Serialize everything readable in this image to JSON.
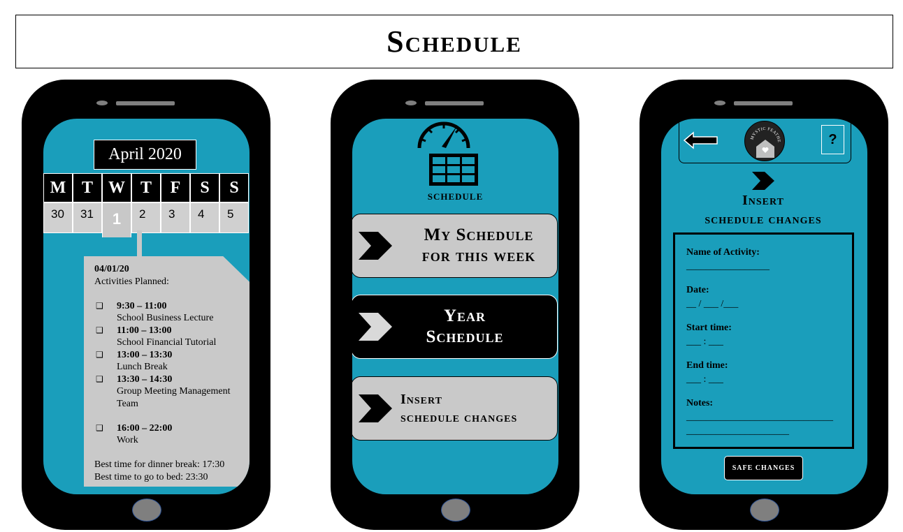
{
  "page": {
    "title": "Schedule"
  },
  "phone1": {
    "month": "April 2020",
    "weekdays": [
      "M",
      "T",
      "W",
      "T",
      "F",
      "S",
      "S"
    ],
    "days": [
      "30",
      "31",
      "1",
      "2",
      "3",
      "4",
      "5"
    ],
    "selected_day_index": 2,
    "date": "04/01/20",
    "activities_header": "Activities Planned:",
    "checkbox_glyph": "❑",
    "activities": [
      {
        "time": "9:30 – 11:00",
        "desc": "School Business   Lecture"
      },
      {
        "time": "11:00 – 13:00",
        "desc": "School Financial Tutorial"
      },
      {
        "time": "13:00 – 13:30",
        "desc": "Lunch Break"
      },
      {
        "time": "13:30 – 14:30",
        "desc": "Group Meeting Management Team"
      },
      {
        "time": "16:00 – 22:00",
        "desc": "Work"
      }
    ],
    "best_dinner": "Best time for dinner break: 17:30",
    "best_bed": "Best time to go to bed: 23:30"
  },
  "phone2": {
    "icon_label": "schedule",
    "buttons": [
      {
        "label_line1": "My Schedule",
        "label_line2": "for this week"
      },
      {
        "label_line1": "Year",
        "label_line2": "Schedule"
      },
      {
        "label_line1": "Insert",
        "label_line2": "schedule changes"
      }
    ]
  },
  "phone3": {
    "logo_text": "MYSTIC FEATHERS",
    "help_label": "?",
    "title_line1": "Insert",
    "title_line2": "schedule changes",
    "fields": {
      "name_label": "Name of Activity:",
      "name_blank": "_________________",
      "date_label": "Date:",
      "date_blank": "__ / ___ /___",
      "start_label": "Start time:",
      "start_blank": "___ : ___",
      "end_label": "End time:",
      "end_blank": "___ : ___",
      "notes_label": "Notes:",
      "notes_blank1": "______________________________",
      "notes_blank2": "_____________________"
    },
    "save_label": "SAFE CHANGES"
  },
  "colors": {
    "screen": "#1a9ebb",
    "card_gray": "#c9c9c9",
    "phone_body": "#000000",
    "button_gray": "#7f7f7f"
  }
}
